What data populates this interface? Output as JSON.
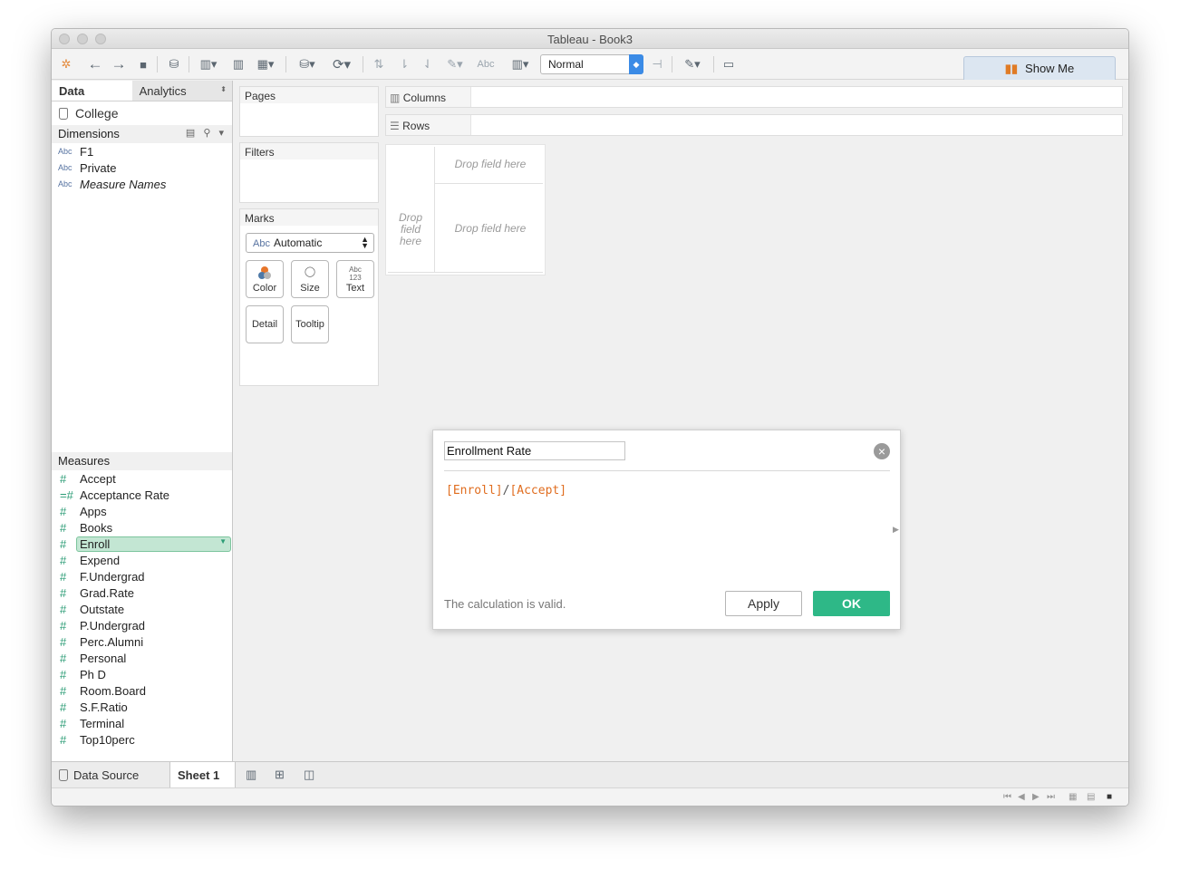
{
  "window": {
    "title": "Tableau - Book3"
  },
  "toolbar": {
    "fit_value": "Normal",
    "show_me_label": "Show Me"
  },
  "data_pane": {
    "tabs": [
      "Data",
      "Analytics"
    ],
    "datasource": "College",
    "dimensions_header": "Dimensions",
    "dimensions": [
      {
        "type": "Abc",
        "name": "F1"
      },
      {
        "type": "Abc",
        "name": "Private"
      },
      {
        "type": "Abc",
        "name": "Measure Names"
      }
    ],
    "measures_header": "Measures",
    "measures": [
      "Accept",
      "Acceptance Rate",
      "Apps",
      "Books",
      "Enroll",
      "Expend",
      "F.Undergrad",
      "Grad.Rate",
      "Outstate",
      "P.Undergrad",
      "Perc.Alumni",
      "Personal",
      "Ph D",
      "Room.Board",
      "S.F.Ratio",
      "Terminal",
      "Top10perc"
    ]
  },
  "shelves": {
    "pages": "Pages",
    "filters": "Filters",
    "marks": "Marks",
    "mark_type": "Automatic",
    "mark_type_icon": "Abc",
    "buttons": [
      "Color",
      "Size",
      "Text",
      "Detail",
      "Tooltip"
    ],
    "text_icon_top": "Abc",
    "text_icon_bottom": "123",
    "columns": "Columns",
    "rows": "Rows"
  },
  "view": {
    "drop_placeholder": "Drop field here",
    "drop_left": [
      "Drop",
      "field",
      "here"
    ]
  },
  "calc_dialog": {
    "name": "Enrollment Rate",
    "formula_field1": "[Enroll]",
    "formula_op": "/",
    "formula_field2": "[Accept]",
    "status": "The calculation is valid.",
    "apply_label": "Apply",
    "ok_label": "OK"
  },
  "bottom_tabs": {
    "datasource_label": "Data Source",
    "sheet_label": "Sheet 1"
  },
  "colors": {
    "ok_button": "#2eb887",
    "formula_field": "#e06d1f",
    "measure_icon": "#2c9c76",
    "selected_field": "#c3e6d3"
  }
}
